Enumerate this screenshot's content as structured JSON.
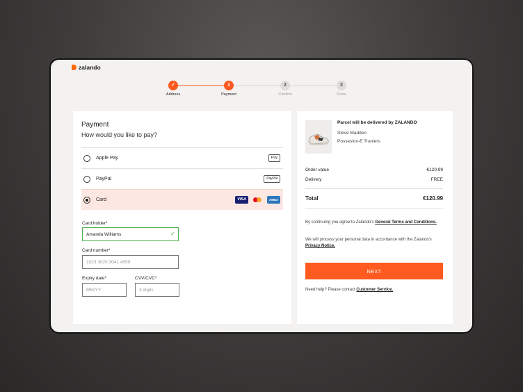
{
  "brand": {
    "name": "zalando",
    "accent": "#ff5a1f"
  },
  "stepper": {
    "steps": [
      {
        "number": "✓",
        "label": "Address",
        "state": "done"
      },
      {
        "number": "1",
        "label": "Payment",
        "state": "active"
      },
      {
        "number": "2",
        "label": "Confirm",
        "state": "todo"
      },
      {
        "number": "3",
        "label": "Done",
        "state": "todo"
      }
    ]
  },
  "payment": {
    "title": "Payment",
    "subtitle": "How would you like to pay?",
    "options": [
      {
        "label": "Apple Pay",
        "badge": " Pay",
        "selected": false
      },
      {
        "label": "PayPal",
        "badge": "PayPal",
        "selected": false
      },
      {
        "label": "Card",
        "badges": [
          "VISA",
          "mastercard",
          "AMEX"
        ],
        "selected": true
      }
    ],
    "card_form": {
      "holder_label": "Card holder*",
      "holder_value": "Amanda Williams",
      "number_label": "Card number*",
      "number_placeholder": "1023 3020 3041 4059",
      "expiry_label": "Expiry date*",
      "expiry_placeholder": "MM/YY",
      "cvv_label": "CVV/CVC*",
      "cvv_placeholder": "3 digits"
    }
  },
  "summary": {
    "delivery_note": "Parcel will be delivered by ZALANDO",
    "product_brand": "Steve Madden",
    "product_name": "Possesion-E Traniers",
    "order_value_label": "Order value",
    "order_value": "€120.99",
    "delivery_label": "Delivery",
    "delivery_value": "FREE",
    "total_label": "Total",
    "total_value": "€120.99",
    "terms_prefix": "By continuing you agree to Zalando's",
    "terms_link": "General Terms and Conditions.",
    "privacy_prefix": "We will process your personal data in accordance with the Zalando's",
    "privacy_link": "Privacy Notice.",
    "next_label": "NEXT",
    "help_prefix": "Need help? Please contact",
    "help_link": "Customer Service."
  }
}
